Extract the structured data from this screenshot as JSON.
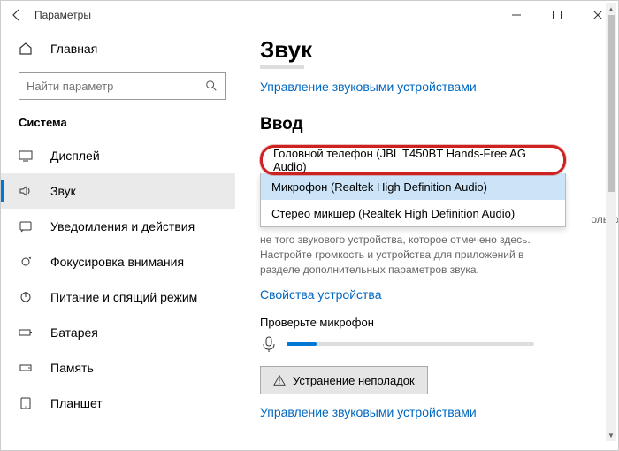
{
  "titlebar": {
    "back": "←",
    "title": "Параметры"
  },
  "sidebar": {
    "home_label": "Главная",
    "search_placeholder": "Найти параметр",
    "category": "Система",
    "items": [
      {
        "label": "Дисплей"
      },
      {
        "label": "Звук"
      },
      {
        "label": "Уведомления и действия"
      },
      {
        "label": "Фокусировка внимания"
      },
      {
        "label": "Питание и спящий режим"
      },
      {
        "label": "Батарея"
      },
      {
        "label": "Память"
      },
      {
        "label": "Планшет"
      }
    ]
  },
  "main": {
    "page_title": "Звук",
    "manage_link": "Управление звуковыми устройствами",
    "input_section": "Ввод",
    "dropdown": {
      "selected": "Головной телефон (JBL T450BT Hands-Free AG Audio)",
      "options": [
        "Микрофон (Realtek High Definition Audio)",
        "Стерео микшер (Realtek High Definition Audio)"
      ]
    },
    "help_text_partial_right": "ользование",
    "help_text": "не того звукового устройства, которое отмечено здесь. Настройте громкость и устройства для приложений в разделе дополнительных параметров звука.",
    "device_props_link": "Свойства устройства",
    "test_mic_label": "Проверьте микрофон",
    "troubleshoot_label": "Устранение неполадок",
    "manage_link2": "Управление звуковыми устройствами"
  }
}
